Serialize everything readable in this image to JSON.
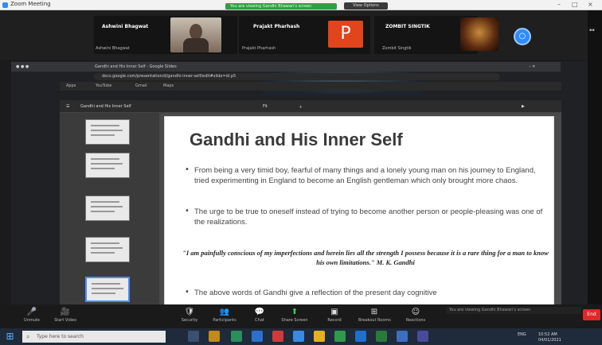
{
  "window": {
    "title": "Zoom Meeting",
    "banner": "You are viewing Gandhi Bhawan's screen",
    "view_button": "View Options"
  },
  "participants": [
    {
      "name": "Ashwini Bhagwat",
      "sub": "Ashwini Bhagwat"
    },
    {
      "name": "Prajakt Pharhash",
      "sub": "Prajakt Pharhash",
      "initial": "P"
    },
    {
      "name": "ZOMBIT SINGTIK",
      "sub": "Zombit Singtik"
    }
  ],
  "browser": {
    "tab": "Gandhi and His Inner Self - Google Slides",
    "address": "docs.google.com/presentation/d/gandhi-inner-self/edit#slide=id.p5",
    "bookmarks": [
      "Apps",
      "YouTube",
      "Gmail",
      "Maps"
    ]
  },
  "slides": {
    "doc_title": "Gandhi and His Inner Self",
    "toolbar_zoom": "Fit",
    "title": "Gandhi and His Inner Self",
    "bullets": [
      "From being a very timid boy, fearful of many things and a lonely young man on his journey to England, tried experimenting in England to become an English gentleman which only brought more chaos.",
      "The urge to be true to oneself instead of trying to become another person or people-pleasing was one of the realizations.",
      "The above words of Gandhi give a reflection of the present day cognitive"
    ],
    "quote": "\"I am painfully conscious of my imperfections and herein lies all the strength I possess because it is a rare thing for a man to know his own limitations.\" M. K. Gandhi"
  },
  "controls": [
    {
      "icon": "🎤",
      "label": "Unmute"
    },
    {
      "icon": "🎥",
      "label": "Start Video"
    },
    {
      "icon": "🛡",
      "label": "Security"
    },
    {
      "icon": "👥",
      "label": "Participants"
    },
    {
      "icon": "💬",
      "label": "Chat"
    },
    {
      "icon": "⬆",
      "label": "Share Screen"
    },
    {
      "icon": "▣",
      "label": "Record"
    },
    {
      "icon": "⊞",
      "label": "Breakout Rooms"
    },
    {
      "icon": "☺",
      "label": "Reactions"
    }
  ],
  "leave_label": "End",
  "tooltip": "You are viewing Gandhi Bhawan's screen",
  "taskbar": {
    "search_placeholder": "Type here to search",
    "time": "10:52 AM",
    "date": "04/01/2021",
    "lang": "ENG"
  }
}
